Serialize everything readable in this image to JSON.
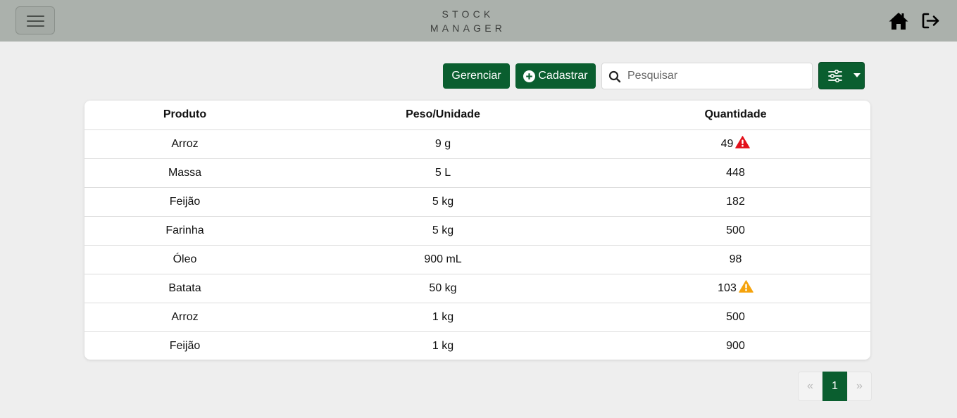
{
  "brand": {
    "line1": "STOCK",
    "line2": "MANAGER"
  },
  "nav": {
    "menu_icon": "hamburger-icon",
    "home_icon": "home-icon",
    "logout_icon": "logout-icon"
  },
  "toolbar": {
    "manage_label": "Gerenciar",
    "register_label": "Cadastrar",
    "search_placeholder": "Pesquisar",
    "search_value": ""
  },
  "table": {
    "headers": [
      "Produto",
      "Peso/Unidade",
      "Quantidade"
    ],
    "rows": [
      {
        "product": "Arroz",
        "weight": "9 g",
        "quantity": "49",
        "alert": "danger"
      },
      {
        "product": "Massa",
        "weight": "5 L",
        "quantity": "448",
        "alert": ""
      },
      {
        "product": "Feijão",
        "weight": "5 kg",
        "quantity": "182",
        "alert": ""
      },
      {
        "product": "Farinha",
        "weight": "5 kg",
        "quantity": "500",
        "alert": ""
      },
      {
        "product": "Óleo",
        "weight": "900 mL",
        "quantity": "98",
        "alert": ""
      },
      {
        "product": "Batata",
        "weight": "50 kg",
        "quantity": "103",
        "alert": "warning"
      },
      {
        "product": "Arroz",
        "weight": "1 kg",
        "quantity": "500",
        "alert": ""
      },
      {
        "product": "Feijão",
        "weight": "1 kg",
        "quantity": "900",
        "alert": ""
      }
    ]
  },
  "pagination": {
    "prev": "«",
    "current": "1",
    "next": "»"
  },
  "colors": {
    "primary": "#0a5e2f",
    "navbar": "#abb1ac",
    "background": "#eeeeee",
    "danger": "#e3101a",
    "warning": "#f5a30c"
  }
}
